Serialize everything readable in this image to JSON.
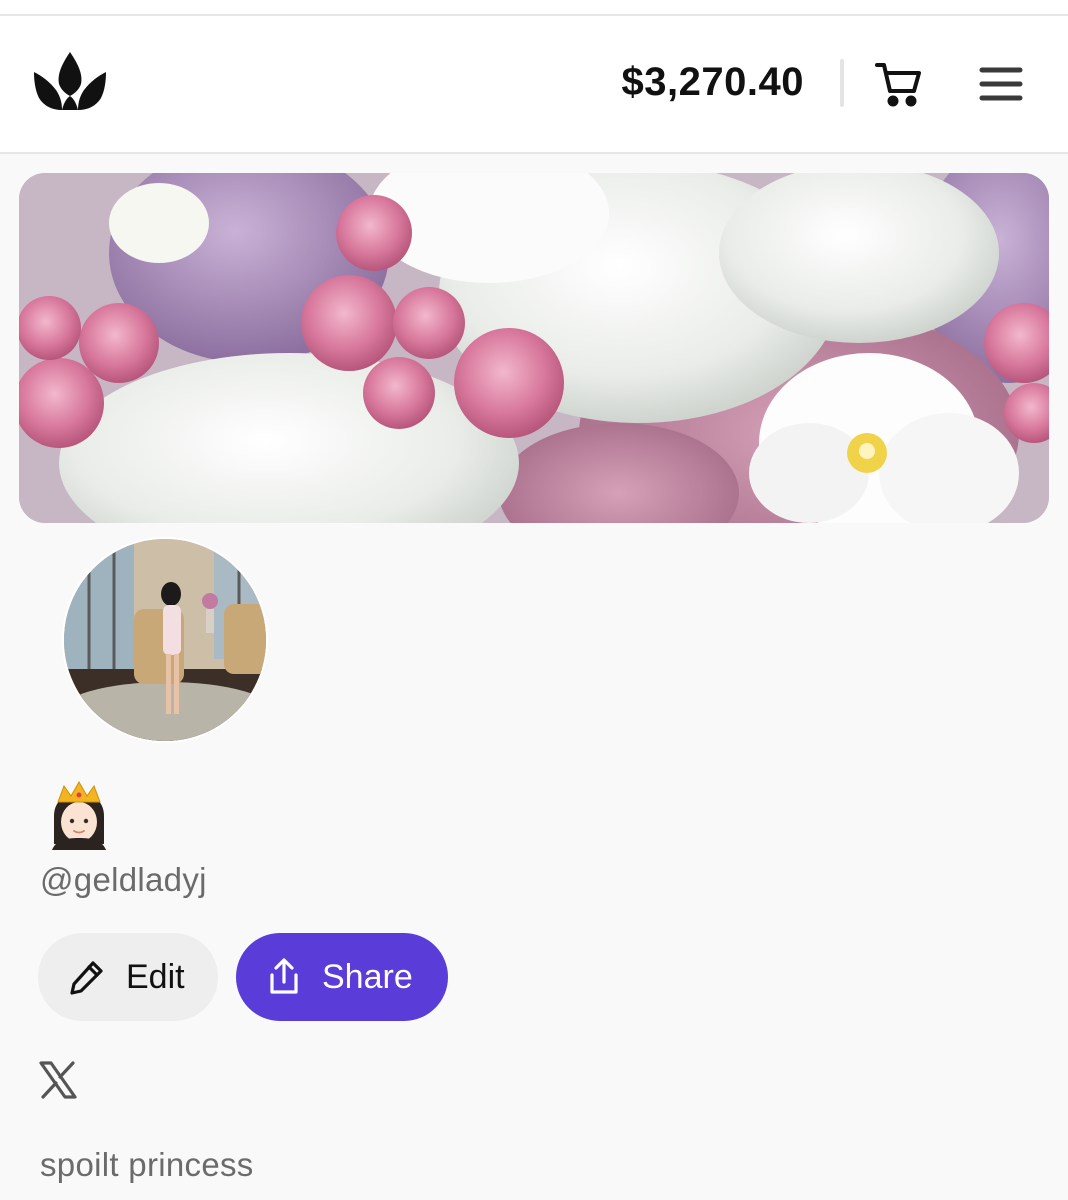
{
  "header": {
    "logo_icon": "crown-lotus-logo",
    "balance": "$3,270.40",
    "cart_icon": "shopping-cart-icon",
    "menu_icon": "hamburger-menu-icon"
  },
  "profile": {
    "banner_image": "flower-bouquet-banner",
    "avatar_image": "profile-photo",
    "display_name_emoji": "👸🏻",
    "handle": "@geldladyj",
    "bio": "spoilt princess"
  },
  "actions": {
    "edit_label": "Edit",
    "edit_icon": "pencil-icon",
    "share_label": "Share",
    "share_icon": "share-upload-icon"
  },
  "social": {
    "x_icon": "x-logo-icon"
  },
  "colors": {
    "accent": "#5a3cd9",
    "muted_text": "#6b6b6b",
    "edit_button_bg": "#eeeeee"
  }
}
